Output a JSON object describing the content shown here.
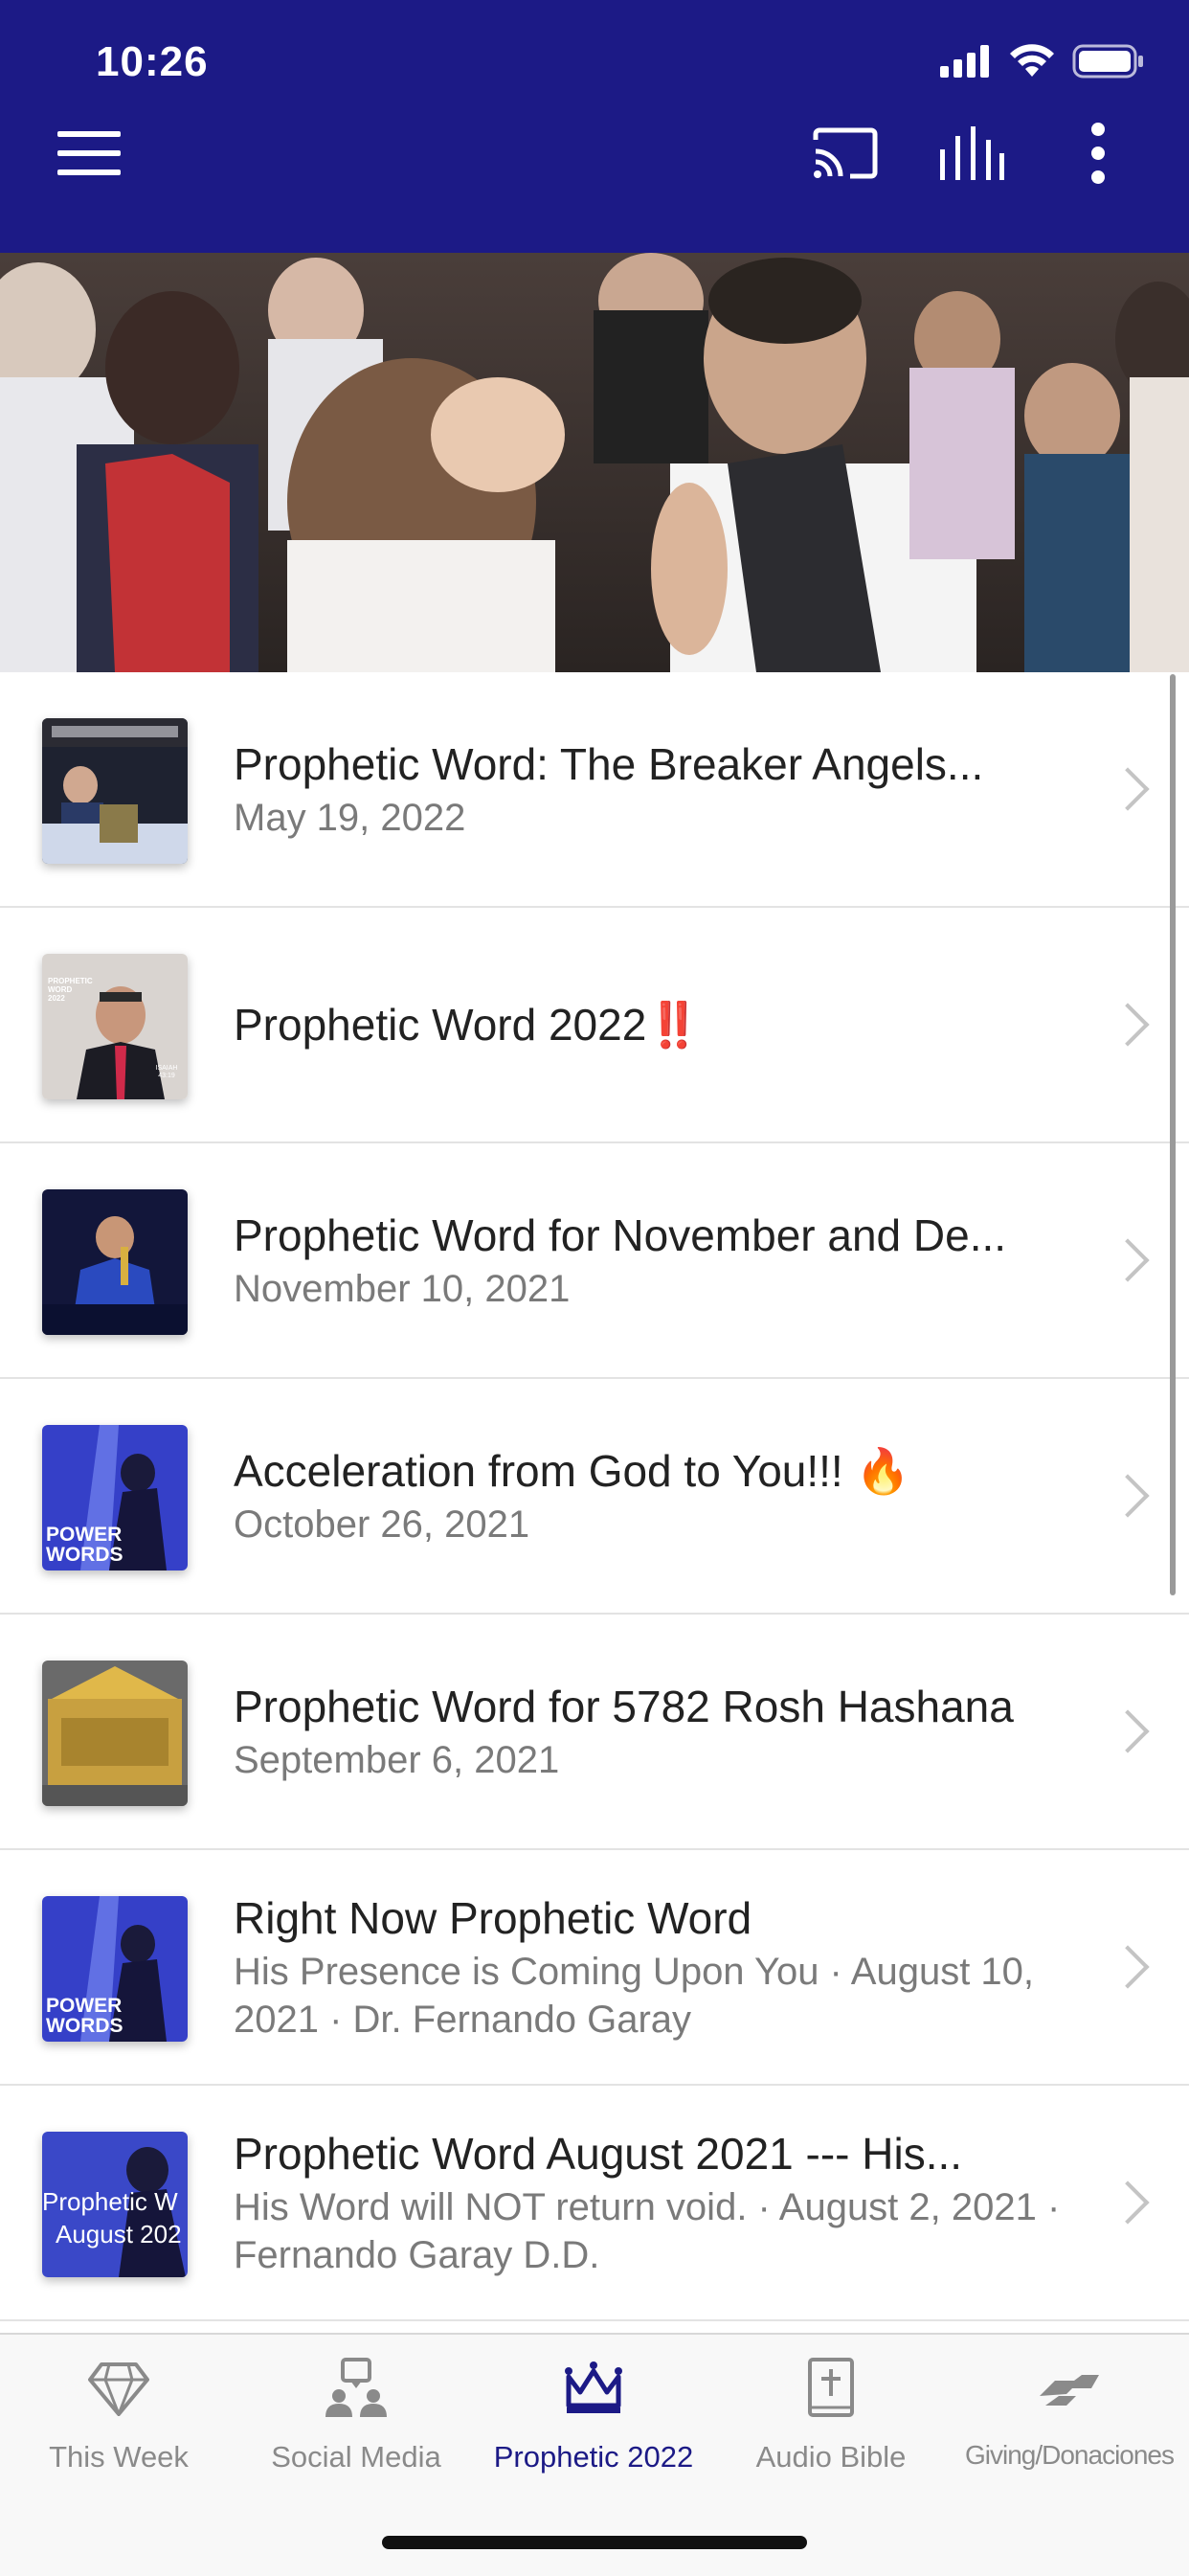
{
  "status_bar": {
    "time": "10:26"
  },
  "colors": {
    "brand": "#1c1a86",
    "tab_inactive": "#8a8a8a",
    "subtitle": "#7a7a7a"
  },
  "toolbar": {
    "menu_icon": "hamburger-icon",
    "cast_icon": "cast-icon",
    "audio_icon": "equalizer-icon",
    "more_icon": "more-vertical-icon"
  },
  "list": {
    "items": [
      {
        "title": "Prophetic Word: The Breaker Angels...",
        "subtitle": "May 19, 2022",
        "thumb_text": ""
      },
      {
        "title": "Prophetic Word 2022",
        "title_suffix": "‼️",
        "subtitle": "",
        "thumb_text": "PROPHETIC WORD 2022",
        "thumb_text2": "ISAIAH 43:19"
      },
      {
        "title": "Prophetic Word for November and De...",
        "subtitle": "November 10, 2021",
        "thumb_text": ""
      },
      {
        "title": "Acceleration from God to You!!! 🔥",
        "subtitle": "October 26, 2021",
        "thumb_text": "POWER",
        "thumb_text2": "WORDS"
      },
      {
        "title": "Prophetic Word for 5782 Rosh Hashana",
        "subtitle": "September 6, 2021",
        "thumb_text": ""
      },
      {
        "title": "Right Now Prophetic Word",
        "subtitle": "His Presence is Coming Upon You · August 10, 2021 · Dr. Fernando Garay",
        "thumb_text": "POWER",
        "thumb_text2": "WORDS"
      },
      {
        "title": "Prophetic Word August 2021 --- His...",
        "subtitle": "His Word will NOT return void. · August 2, 2021 · Fernando Garay D.D.",
        "thumb_text": "Prophetic W",
        "thumb_text2": "August 202"
      }
    ]
  },
  "tabs": [
    {
      "label": "This Week",
      "icon": "diamond-icon",
      "active": false
    },
    {
      "label": "Social Media",
      "icon": "people-icon",
      "active": false
    },
    {
      "label": "Prophetic 2022",
      "icon": "crown-icon",
      "active": true
    },
    {
      "label": "Audio Bible",
      "icon": "bible-icon",
      "active": false
    },
    {
      "label": "Giving/Donaciones",
      "icon": "handshake-icon",
      "active": false
    }
  ]
}
